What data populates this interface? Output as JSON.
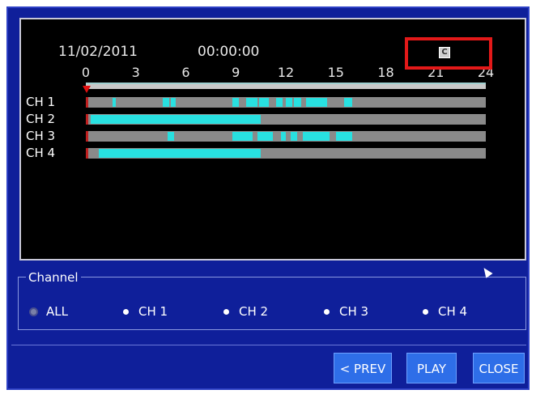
{
  "header": {
    "date": "11/02/2011",
    "time": "00:00:00"
  },
  "timeline": {
    "hour_labels": [
      "0",
      "3",
      "6",
      "9",
      "12",
      "15",
      "18",
      "21",
      "24"
    ],
    "channels": [
      {
        "label": "CH 1",
        "segments": [
          [
            1.6,
            1.8
          ],
          [
            4.6,
            5.0
          ],
          [
            5.1,
            5.4
          ],
          [
            8.8,
            9.2
          ],
          [
            9.6,
            10.3
          ],
          [
            10.4,
            11.0
          ],
          [
            11.4,
            11.8
          ],
          [
            12.0,
            12.4
          ],
          [
            12.5,
            12.9
          ],
          [
            13.2,
            14.5
          ],
          [
            15.5,
            16.0
          ]
        ]
      },
      {
        "label": "CH 2",
        "segments": [
          [
            0.3,
            10.5
          ]
        ]
      },
      {
        "label": "CH 3",
        "segments": [
          [
            4.9,
            5.3
          ],
          [
            8.8,
            10.0
          ],
          [
            10.3,
            11.2
          ],
          [
            11.7,
            12.0
          ],
          [
            12.3,
            12.7
          ],
          [
            13.0,
            14.6
          ],
          [
            15.0,
            16.0
          ]
        ]
      },
      {
        "label": "CH 4",
        "segments": [
          [
            0.8,
            10.5
          ]
        ]
      }
    ]
  },
  "channel_group": {
    "legend": "Channel",
    "options": [
      {
        "label": "ALL",
        "selected": true
      },
      {
        "label": "CH 1",
        "selected": false
      },
      {
        "label": "CH 2",
        "selected": false
      },
      {
        "label": "CH 3",
        "selected": false
      },
      {
        "label": "CH 4",
        "selected": false
      }
    ]
  },
  "buttons": {
    "prev": "< PREV",
    "play": "PLAY",
    "close": "CLOSE"
  },
  "colors": {
    "background": "#0f1f9a",
    "record": "#28e0e0",
    "highlight": "#e31919",
    "button": "#2e6ee8"
  }
}
